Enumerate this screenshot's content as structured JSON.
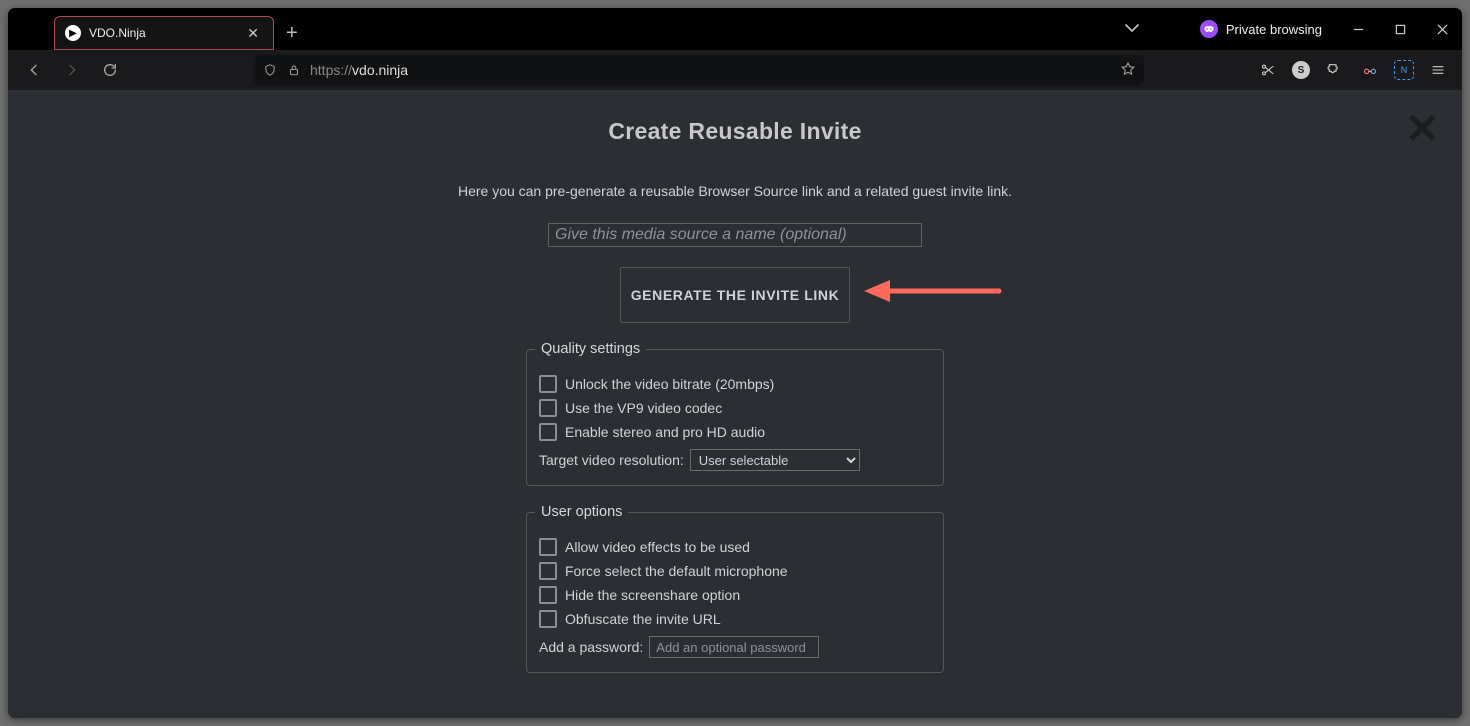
{
  "browser": {
    "tab_title": "VDO.Ninja",
    "private_label": "Private browsing",
    "url_prefix": "https://",
    "url_host": "vdo.ninja"
  },
  "page": {
    "title": "Create Reusable Invite",
    "subtitle": "Here you can pre-generate a reusable Browser Source link and a related guest invite link.",
    "name_placeholder": "Give this media source a name (optional)",
    "generate_button": "GENERATE THE INVITE LINK",
    "quality": {
      "legend": "Quality settings",
      "unlock_bitrate": "Unlock the video bitrate (20mbps)",
      "vp9": "Use the VP9 video codec",
      "stereo": "Enable stereo and pro HD audio",
      "resolution_label": "Target video resolution:",
      "resolution_value": "User selectable"
    },
    "user": {
      "legend": "User options",
      "effects": "Allow video effects to be used",
      "mic": "Force select the default microphone",
      "screenshare": "Hide the screenshare option",
      "obfuscate": "Obfuscate the invite URL",
      "password_label": "Add a password:",
      "password_placeholder": "Add an optional password"
    }
  }
}
